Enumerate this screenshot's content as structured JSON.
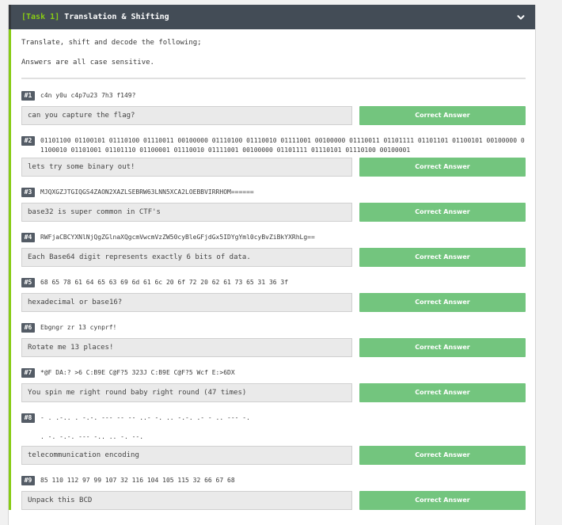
{
  "task": {
    "tag": "[Task 1]",
    "title": "Translation & Shifting",
    "toggle_icon": "chevron-down-icon"
  },
  "intro": {
    "line1": "Translate, shift and decode the following;",
    "line2": "Answers are all case sensitive."
  },
  "button_label": "Correct Answer",
  "colors": {
    "header_bg": "#434c56",
    "accent_green": "#88cc14",
    "button_green": "#73c57e",
    "badge_bg": "#545c66"
  },
  "questions": [
    {
      "number": "#1",
      "text": "c4n y0u c4p7u23 7h3 f149?",
      "answer": "can you capture the flag?"
    },
    {
      "number": "#2",
      "text": "01101100 01100101 01110100 01110011 00100000 01110100 01110010 01111001 00100000 01110011 01101111 01101101 01100101 00100000 01100010 01101001 01101110 01100001 01110010 01111001 00100000 01101111 01110101 01110100 00100001",
      "answer": "lets try some binary out!"
    },
    {
      "number": "#3",
      "text": "MJQXGZJTGIQGS4ZAON2XAZLSEBRW63LNN5XCA2LOEBBVIRRHOM======",
      "answer": "base32 is super common in CTF's"
    },
    {
      "number": "#4",
      "text": "RWFjaCBCYXNlNjQgZGlnaXQgcmVwcmVzZW50cyBleGFjdGx5IDYgYml0cyBvZiBkYXRhLg==",
      "answer": "Each Base64 digit represents exactly 6 bits of data."
    },
    {
      "number": "#5",
      "text": "68 65 78 61 64 65 63 69 6d 61 6c 20 6f 72 20 62 61 73 65 31 36 3f",
      "answer": "hexadecimal or base16?"
    },
    {
      "number": "#6",
      "text": "Ebgngr zr 13 cynprf!",
      "answer": "Rotate me 13 places!"
    },
    {
      "number": "#7",
      "text": "*@F DA:? >6 C:B9E C@F?5 323J C:B9E C@F?5 Wcf E:>6DX",
      "answer": "You spin me right round baby right round (47 times)"
    },
    {
      "number": "#8",
      "text": "- . .-.. . -.-. --- -- -- ..- -. .. -.-. .- - .. --- -.\n\n. -. -.-. --- -.. .. -. --.",
      "answer": "telecommunication encoding"
    },
    {
      "number": "#9",
      "text": "85 110 112 97 99 107 32 116 104 105 115 32 66 67 68",
      "answer": "Unpack this BCD"
    }
  ]
}
